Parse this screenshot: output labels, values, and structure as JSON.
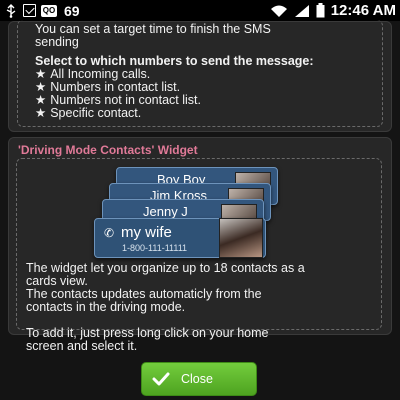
{
  "status_bar": {
    "notification_count": "69",
    "voicemail_label": "QO",
    "time": "12:46 AM",
    "icons": [
      "usb-icon",
      "message-icon",
      "voicemail-icon",
      "wifi-icon",
      "signal-icon",
      "battery-icon"
    ]
  },
  "info_panel": {
    "target_time_text_line1": "You can set a target time to finish the SMS",
    "target_time_text_line2": "sending",
    "select_heading": "Select to which numbers to send the message:",
    "options": [
      "All Incoming calls.",
      "Numbers in contact list.",
      "Numbers not in contact list.",
      "Specific contact."
    ],
    "bullet": "★"
  },
  "widget_section": {
    "title": "'Driving Mode Contacts' Widget",
    "cards": [
      {
        "name": "Boy Boy"
      },
      {
        "name": "Jim Kross"
      },
      {
        "name": "Jenny J"
      },
      {
        "name": "my wife",
        "number": "1-800-111-11111"
      }
    ],
    "description": [
      "The widget let you organize up to 18 contacts as a",
      "cards view.",
      "The contacts updates automaticly from the",
      "contacts in the driving mode.",
      "",
      "To add it, just press long click on your home",
      "screen and select it."
    ]
  },
  "close_button": {
    "label": "Close"
  },
  "colors": {
    "accent_title": "#e07a98",
    "button_green": "#5cb82c",
    "card_blue": "#33567d"
  }
}
